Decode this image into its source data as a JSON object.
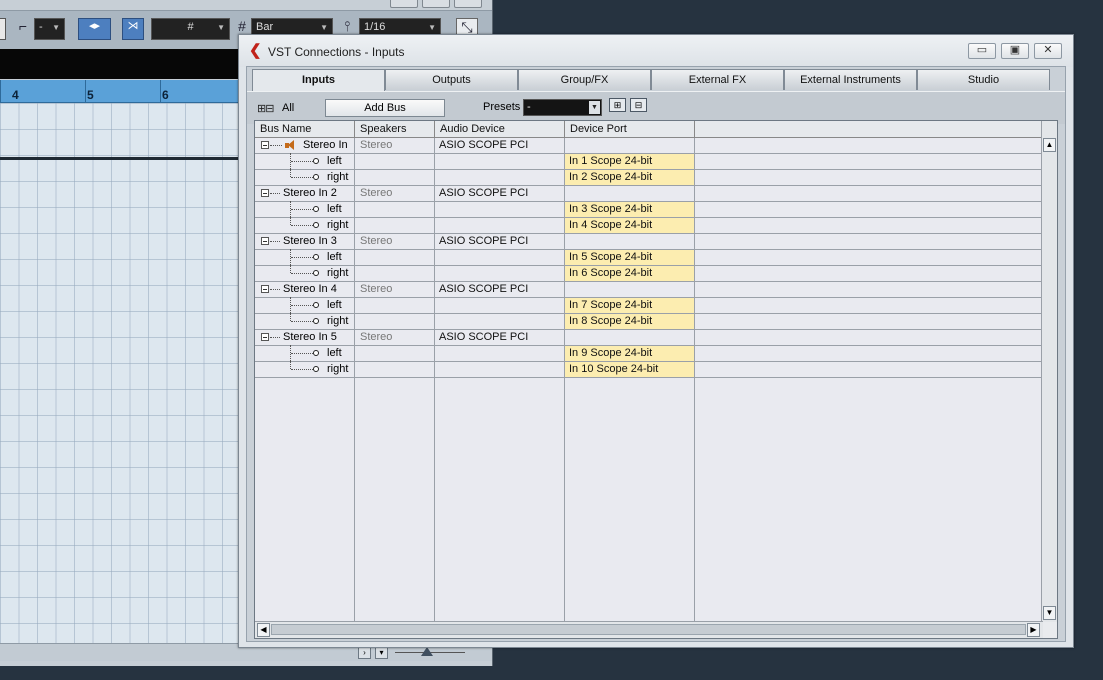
{
  "project": {
    "toolbar": {
      "quantize_value": "-",
      "grid_type": "Bar",
      "quantize_step": "1/16"
    },
    "ruler_ticks": [
      "4",
      "5",
      "6"
    ]
  },
  "dialog": {
    "title": "VST Connections - Inputs",
    "tabs": [
      {
        "label": "Inputs",
        "active": true
      },
      {
        "label": "Outputs",
        "active": false
      },
      {
        "label": "Group/FX",
        "active": false
      },
      {
        "label": "External FX",
        "active": false
      },
      {
        "label": "External Instruments",
        "active": false
      },
      {
        "label": "Studio",
        "active": false
      }
    ],
    "toolbar": {
      "all_label": "All",
      "add_bus_label": "Add Bus",
      "presets_label": "Presets",
      "presets_value": "-"
    },
    "table": {
      "headers": [
        "Bus Name",
        "Speakers",
        "Audio Device",
        "Device Port"
      ],
      "rows": [
        {
          "kind": "bus",
          "name": "Stereo In",
          "speakers": "Stereo",
          "device": "ASIO SCOPE PCI",
          "port": "",
          "icon": "speaker-icon"
        },
        {
          "kind": "channel",
          "name": "left",
          "port": "In 1 Scope 24-bit"
        },
        {
          "kind": "channel",
          "name": "right",
          "port": "In 2 Scope 24-bit"
        },
        {
          "kind": "bus",
          "name": "Stereo In 2",
          "speakers": "Stereo",
          "device": "ASIO SCOPE PCI",
          "port": ""
        },
        {
          "kind": "channel",
          "name": "left",
          "port": "In 3 Scope 24-bit"
        },
        {
          "kind": "channel",
          "name": "right",
          "port": "In 4 Scope 24-bit"
        },
        {
          "kind": "bus",
          "name": "Stereo In 3",
          "speakers": "Stereo",
          "device": "ASIO SCOPE PCI",
          "port": ""
        },
        {
          "kind": "channel",
          "name": "left",
          "port": "In 5 Scope 24-bit"
        },
        {
          "kind": "channel",
          "name": "right",
          "port": "In 6 Scope 24-bit"
        },
        {
          "kind": "bus",
          "name": "Stereo In 4",
          "speakers": "Stereo",
          "device": "ASIO SCOPE PCI",
          "port": ""
        },
        {
          "kind": "channel",
          "name": "left",
          "port": "In 7 Scope 24-bit"
        },
        {
          "kind": "channel",
          "name": "right",
          "port": "In 8 Scope 24-bit"
        },
        {
          "kind": "bus",
          "name": "Stereo In 5",
          "speakers": "Stereo",
          "device": "ASIO SCOPE PCI",
          "port": ""
        },
        {
          "kind": "channel",
          "name": "left",
          "port": "In 9 Scope 24-bit"
        },
        {
          "kind": "channel",
          "name": "right",
          "port": "In 10 Scope 24-bit"
        }
      ]
    }
  },
  "colors": {
    "port_highlight": "#fcedb0",
    "ruler": "#5aa1d8",
    "speaker_icon": "#c46a1a"
  }
}
